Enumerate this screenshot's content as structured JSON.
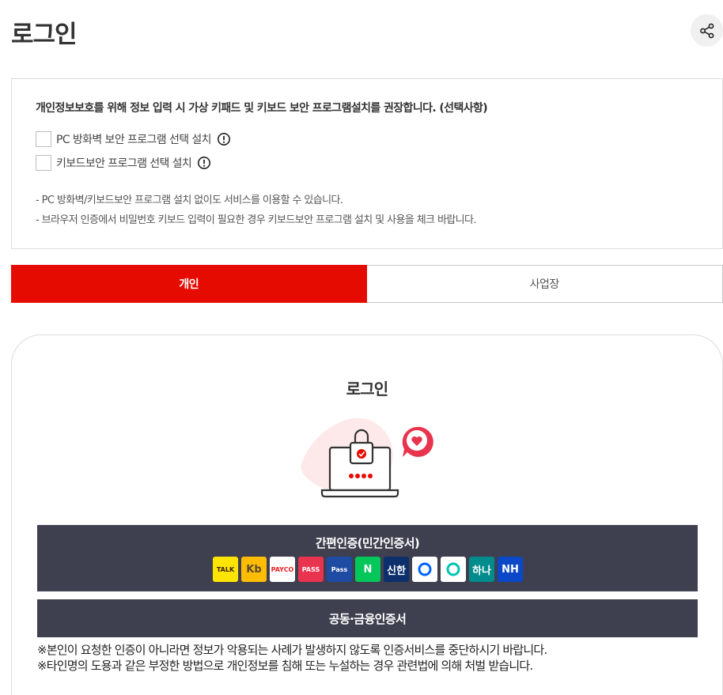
{
  "page": {
    "title": "로그인"
  },
  "notice": {
    "heading": "개인정보보호를 위해 정보 입력 시 가상 키패드 및 키보드 보안 프로그램설치를 권장합니다. (선택사항)",
    "options": [
      {
        "label": "PC 방화벽 보안 프로그램 선택 설치",
        "checked": false
      },
      {
        "label": "키보드보안 프로그램 선택 설치",
        "checked": false
      }
    ],
    "bullets": [
      "PC 방화벽/키보드보안 프로그램 설치 없이도 서비스를 이용할 수 있습니다.",
      "브라우저 인증에서 비밀번호 키보드 입력이 필요한 경우 키보드보안 프로그램 설치 및 사용을 체크 바랍니다."
    ]
  },
  "tabs": [
    {
      "label": "개인",
      "active": true
    },
    {
      "label": "사업장",
      "active": false
    }
  ],
  "login": {
    "title": "로그인",
    "simple_cert": {
      "label": "간편인증(민간인증서)",
      "providers": [
        {
          "name": "kakao",
          "text": "TALK",
          "bg": "#fee500",
          "fg": "#3a1d1d"
        },
        {
          "name": "kb",
          "text": "Kb",
          "bg": "#ffbc00",
          "fg": "#5a4a33"
        },
        {
          "name": "payco",
          "text": "PAYCO",
          "bg": "#ffffff",
          "fg": "#e52528"
        },
        {
          "name": "pass",
          "text": "PASS",
          "bg": "#e8344e",
          "fg": "#ffffff"
        },
        {
          "name": "samsung-pass",
          "text": "Pass",
          "bg": "#1e4ba3",
          "fg": "#ffffff"
        },
        {
          "name": "naver",
          "text": "N",
          "bg": "#03c75a",
          "fg": "#ffffff"
        },
        {
          "name": "shinhan",
          "text": "신한",
          "bg": "#0d2f6b",
          "fg": "#ffffff"
        },
        {
          "name": "toss",
          "text": "",
          "bg": "#ffffff",
          "fg": "#0064ff"
        },
        {
          "name": "banksalad",
          "text": "",
          "bg": "#ffffff",
          "fg": "#00c4b3"
        },
        {
          "name": "hana",
          "text": "하나",
          "bg": "#008c8c",
          "fg": "#ffffff"
        },
        {
          "name": "nh",
          "text": "NH",
          "bg": "#0b48c8",
          "fg": "#ffffff"
        }
      ]
    },
    "joint_cert": {
      "label": "공동·금융인증서"
    },
    "warnings": [
      "※본인이 요청한 인증이 아니라면 정보가 악용되는 사례가 발생하지 않도록 인증서비스를 중단하시기 바랍니다.",
      "※타인명의 도용과 같은 부정한 방법으로 개인정보를 침해 또는 누설하는 경우 관련법에 의해 처벌 받습니다."
    ]
  },
  "colors": {
    "accent": "#e60b00",
    "button_bg": "#3e3f4f"
  }
}
